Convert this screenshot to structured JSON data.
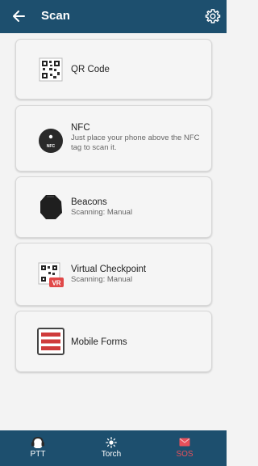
{
  "header": {
    "title": "Scan",
    "back_icon": "arrow-left-icon",
    "settings_icon": "gear-icon"
  },
  "items": [
    {
      "label": "QR Code",
      "sub": "",
      "icon": "qr-code-icon"
    },
    {
      "label": "NFC",
      "sub": "Just place your phone above the NFC tag to scan it.",
      "icon": "nfc-tag-icon"
    },
    {
      "label": "Beacons",
      "sub": "Scanning: Manual",
      "icon": "beacon-icon"
    },
    {
      "label": "Virtual Checkpoint",
      "sub": "Scanning: Manual",
      "icon": "virtual-checkpoint-icon",
      "badge": "VR"
    },
    {
      "label": "Mobile Forms",
      "sub": "",
      "icon": "form-icon"
    }
  ],
  "nfc_tag_text": "NFC",
  "bottom_nav": [
    {
      "label": "PTT",
      "icon": "ptt-icon"
    },
    {
      "label": "Torch",
      "icon": "torch-icon"
    },
    {
      "label": "SOS",
      "icon": "envelope-icon"
    }
  ],
  "colors": {
    "header_bg": "#1d4f6e",
    "nav_text": "#ffffff",
    "sos_text": "#e8505b",
    "form_red": "#cf3b3b"
  }
}
